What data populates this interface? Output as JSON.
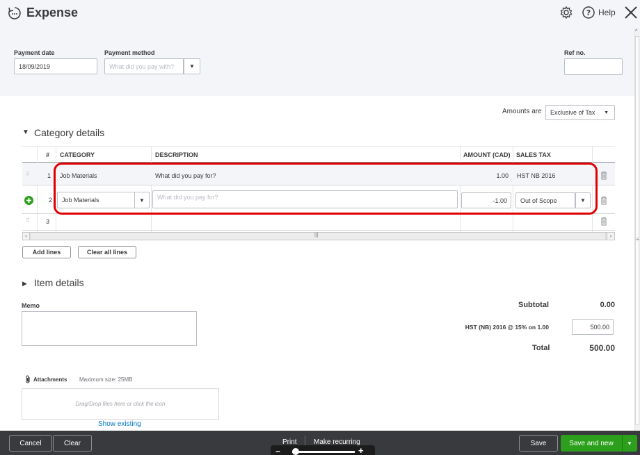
{
  "header": {
    "title": "Expense",
    "help_label": "Help"
  },
  "form": {
    "payment_date_label": "Payment date",
    "payment_date_value": "18/09/2019",
    "payment_method_label": "Payment method",
    "payment_method_placeholder": "What did you pay with?",
    "ref_no_label": "Ref no.",
    "ref_no_value": ""
  },
  "amounts": {
    "label": "Amounts are",
    "value": "Exclusive of Tax"
  },
  "category_details": {
    "title": "Category details",
    "columns": {
      "num": "#",
      "category": "CATEGORY",
      "description": "DESCRIPTION",
      "amount": "AMOUNT (CAD)",
      "sales_tax": "SALES TAX"
    },
    "rows": [
      {
        "num": "1",
        "category": "Job Materials",
        "description_placeholder": "What did you pay for?",
        "amount": "1.00",
        "sales_tax": "HST NB 2016"
      },
      {
        "num": "2",
        "category": "Job Materials",
        "description_placeholder": "What did you pay for?",
        "amount": "-1.00",
        "sales_tax": "Out of Scope"
      },
      {
        "num": "3",
        "category": "",
        "description_placeholder": "",
        "amount": "",
        "sales_tax": ""
      }
    ],
    "add_lines": "Add lines",
    "clear_all_lines": "Clear all lines"
  },
  "item_details": {
    "title": "Item details"
  },
  "memo": {
    "label": "Memo",
    "value": ""
  },
  "totals": {
    "subtotal_label": "Subtotal",
    "subtotal_value": "0.00",
    "tax_label": "HST (NB) 2016 @ 15% on 1.00",
    "tax_value": "500.00",
    "total_label": "Total",
    "total_value": "500.00"
  },
  "attachments": {
    "label": "Attachments",
    "max_size": "Maximum size: 25MB",
    "drop_text": "Drag/Drop files here or click the icon",
    "show_existing": "Show existing"
  },
  "footer": {
    "cancel": "Cancel",
    "clear": "Clear",
    "print": "Print",
    "make_recurring": "Make recurring",
    "save": "Save",
    "save_and_new": "Save and new"
  },
  "colors": {
    "highlight_red": "#e00000",
    "green": "#2ca01c",
    "footer_bg": "#393a3d",
    "link": "#0077c5"
  }
}
